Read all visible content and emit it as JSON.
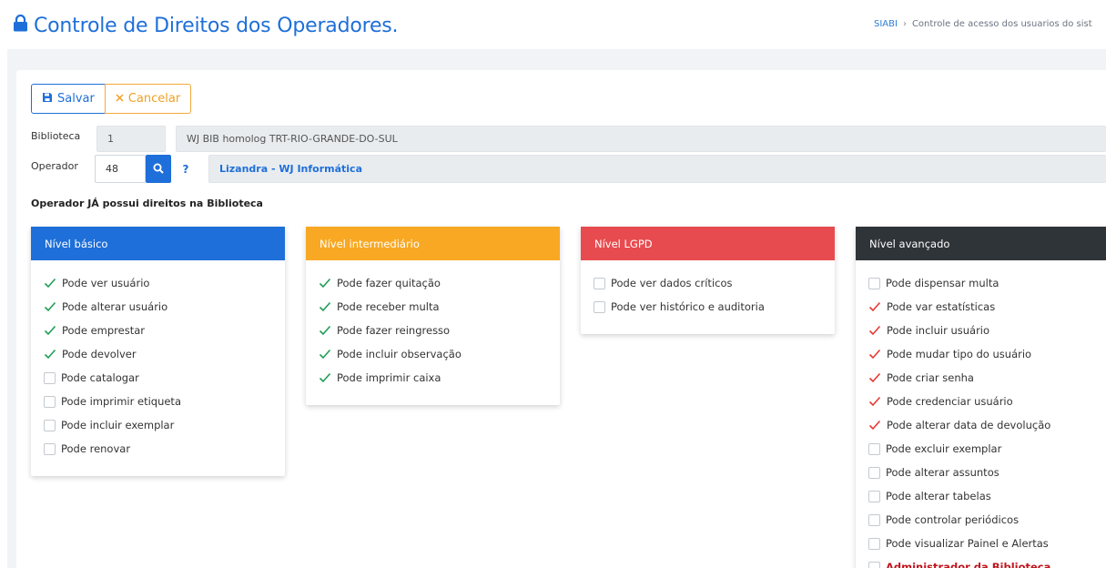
{
  "header": {
    "title": "Controle de Direitos dos Operadores.",
    "breadcrumb_root": "SIABI",
    "breadcrumb_current": "Controle de acesso dos usuarios do sist"
  },
  "toolbar": {
    "save_label": "Salvar",
    "cancel_label": "Cancelar"
  },
  "form": {
    "library_label": "Biblioteca",
    "library_code": "1",
    "library_name": "WJ BIB homolog TRT-RIO-GRANDE-DO-SUL",
    "operator_label": "Operador",
    "operator_code": "48",
    "help_symbol": "?",
    "operator_name": "Lizandra - WJ Informática"
  },
  "notice": "Operador JÁ possui direitos na Biblioteca",
  "colors": {
    "primary": "#1e6fd9",
    "basic": "#1e6fd9",
    "intermediate": "#f8a823",
    "lgpd": "#e84b4f",
    "advanced": "#2f3438",
    "check_green": "#1f9d55",
    "check_red": "#e53935"
  },
  "panels": [
    {
      "title": "Nível básico",
      "color": "#1e6fd9",
      "items": [
        {
          "label": "Pode ver usuário",
          "state": "green"
        },
        {
          "label": "Pode alterar usuário",
          "state": "green"
        },
        {
          "label": "Pode emprestar",
          "state": "green"
        },
        {
          "label": "Pode devolver",
          "state": "green"
        },
        {
          "label": "Pode catalogar",
          "state": "off"
        },
        {
          "label": "Pode imprimir etiqueta",
          "state": "off"
        },
        {
          "label": "Pode incluir exemplar",
          "state": "off"
        },
        {
          "label": "Pode renovar",
          "state": "off"
        }
      ]
    },
    {
      "title": "Nível intermediário",
      "color": "#f8a823",
      "items": [
        {
          "label": "Pode fazer quitação",
          "state": "green"
        },
        {
          "label": "Pode receber multa",
          "state": "green"
        },
        {
          "label": "Pode fazer reingresso",
          "state": "green"
        },
        {
          "label": "Pode incluir observação",
          "state": "green"
        },
        {
          "label": "Pode imprimir caixa",
          "state": "green"
        }
      ]
    },
    {
      "title": "Nível LGPD",
      "color": "#e84b4f",
      "items": [
        {
          "label": "Pode ver dados críticos",
          "state": "off"
        },
        {
          "label": "Pode ver histórico e auditoria",
          "state": "off"
        }
      ]
    },
    {
      "title": "Nível avançado",
      "color": "#2f3438",
      "items": [
        {
          "label": "Pode dispensar multa",
          "state": "off"
        },
        {
          "label": "Pode var estatísticas",
          "state": "red"
        },
        {
          "label": "Pode incluir usuário",
          "state": "red"
        },
        {
          "label": "Pode mudar tipo do usuário",
          "state": "red"
        },
        {
          "label": "Pode criar senha",
          "state": "red"
        },
        {
          "label": "Pode credenciar usuário",
          "state": "red"
        },
        {
          "label": "Pode alterar data de devolução",
          "state": "red"
        },
        {
          "label": "Pode excluir exemplar",
          "state": "off"
        },
        {
          "label": "Pode alterar assuntos",
          "state": "off"
        },
        {
          "label": "Pode alterar tabelas",
          "state": "off"
        },
        {
          "label": "Pode controlar periódicos",
          "state": "off"
        },
        {
          "label": "Pode visualizar Painel e Alertas",
          "state": "off"
        },
        {
          "label": "Administrador da Biblioteca",
          "state": "off",
          "emphasis": true
        }
      ]
    }
  ]
}
